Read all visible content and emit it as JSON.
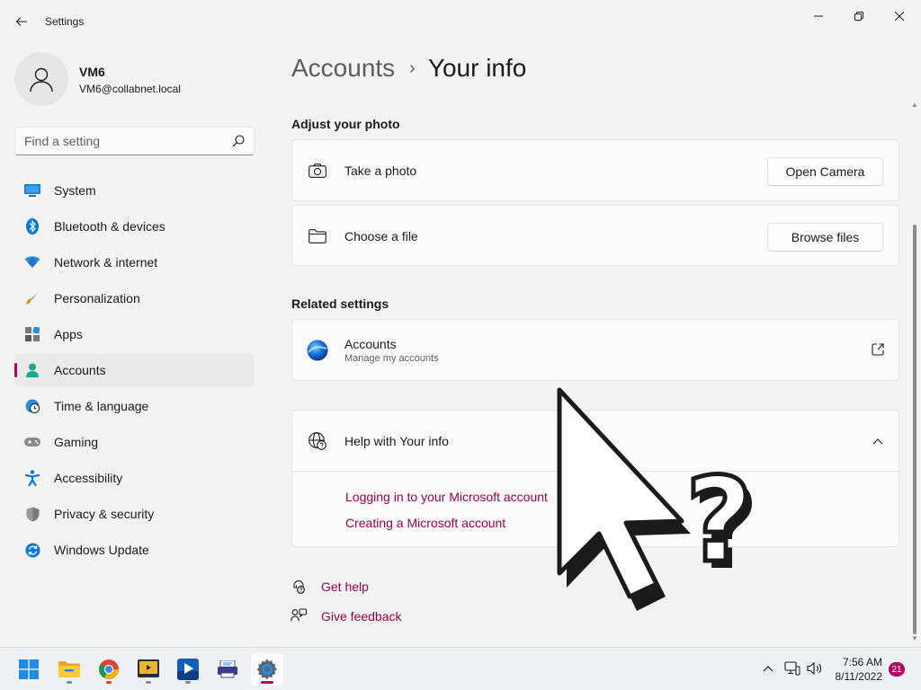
{
  "window": {
    "title": "Settings",
    "accent_color": "#b4005e",
    "link_color": "#9a0050"
  },
  "profile": {
    "name": "VM6",
    "email": "VM6@collabnet.local"
  },
  "search": {
    "placeholder": "Find a setting"
  },
  "sidebar": {
    "items": [
      {
        "label": "System",
        "icon": "system-icon"
      },
      {
        "label": "Bluetooth & devices",
        "icon": "bluetooth-icon"
      },
      {
        "label": "Network & internet",
        "icon": "wifi-icon"
      },
      {
        "label": "Personalization",
        "icon": "brush-icon"
      },
      {
        "label": "Apps",
        "icon": "apps-icon"
      },
      {
        "label": "Accounts",
        "icon": "accounts-icon",
        "selected": true
      },
      {
        "label": "Time & language",
        "icon": "globe-clock-icon"
      },
      {
        "label": "Gaming",
        "icon": "controller-icon"
      },
      {
        "label": "Accessibility",
        "icon": "accessibility-icon"
      },
      {
        "label": "Privacy & security",
        "icon": "shield-icon"
      },
      {
        "label": "Windows Update",
        "icon": "update-icon"
      }
    ]
  },
  "breadcrumb": {
    "parent": "Accounts",
    "separator": "›",
    "current": "Your info"
  },
  "photo_section": {
    "title": "Adjust your photo",
    "take_photo": {
      "label": "Take a photo",
      "button": "Open Camera",
      "icon": "camera-icon"
    },
    "choose_file": {
      "label": "Choose a file",
      "button": "Browse files",
      "icon": "folder-icon"
    }
  },
  "related_section": {
    "title": "Related settings",
    "accounts": {
      "label": "Accounts",
      "sublabel": "Manage my accounts",
      "icon": "microsoft-accounts-icon",
      "action_icon": "open-external-icon"
    }
  },
  "help_section": {
    "title": "Help with Your info",
    "expanded": true,
    "icon": "help-globe-icon",
    "links": [
      "Logging in to your Microsoft account",
      "Creating a Microsoft account"
    ]
  },
  "footer": {
    "get_help": "Get help",
    "give_feedback": "Give feedback"
  },
  "overlay": {
    "symbol": "?"
  },
  "taskbar": {
    "apps": [
      {
        "name": "start",
        "icon": "windows-start-icon"
      },
      {
        "name": "file-explorer",
        "icon": "folder-icon"
      },
      {
        "name": "chrome",
        "icon": "chrome-icon"
      },
      {
        "name": "media-app",
        "icon": "media-icon"
      },
      {
        "name": "media-player",
        "icon": "media-player-icon"
      },
      {
        "name": "scanner-app",
        "icon": "scanner-icon"
      },
      {
        "name": "settings",
        "icon": "gear-icon",
        "active": true
      }
    ],
    "time": "7:56 AM",
    "date": "8/11/2022",
    "notification_count": "21"
  }
}
